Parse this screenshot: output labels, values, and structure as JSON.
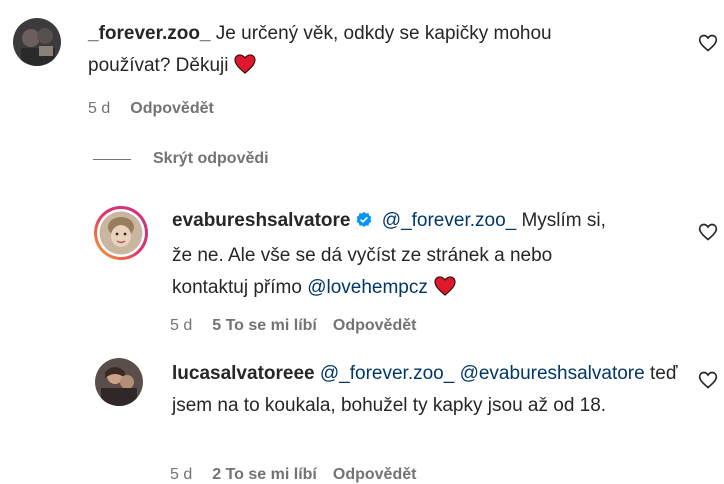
{
  "comments": [
    {
      "username": "_forever.zoo_",
      "text": "Je určený věk, odkdy se kapičky mohou používat? Děkuji",
      "time": "5 d",
      "reply_label": "Odpovědět"
    }
  ],
  "hide_replies_label": "Skrýt odpovědi",
  "replies": [
    {
      "username": "evabureshsalvatore",
      "verified": true,
      "mention1": "@_forever.zoo_",
      "text1": "Myslím si, že ne. Ale vše se dá vyčíst ze stránek a nebo kontaktuj přímo",
      "mention2": "@lovehempcz",
      "time": "5 d",
      "likes": "5 To se mi líbí",
      "reply_label": "Odpovědět"
    },
    {
      "username": "lucasalvatoreee",
      "mention1": "@_forever.zoo_",
      "mention2": "@evabureshsalvatore",
      "text1": "teď jsem na to koukala, bohužel ty kapky jsou až od 18.",
      "time": "5 d",
      "likes": "2 To se mi líbí",
      "reply_label": "Odpovědět"
    }
  ],
  "colors": {
    "text": "#262626",
    "secondary": "#737373",
    "mention": "#00376b",
    "heart": "#e0182d",
    "verified": "#0095f6"
  },
  "icons": {
    "heart_emoji": "heart-emoji-icon",
    "like": "heart-outline-icon",
    "verified": "verified-badge-icon"
  }
}
